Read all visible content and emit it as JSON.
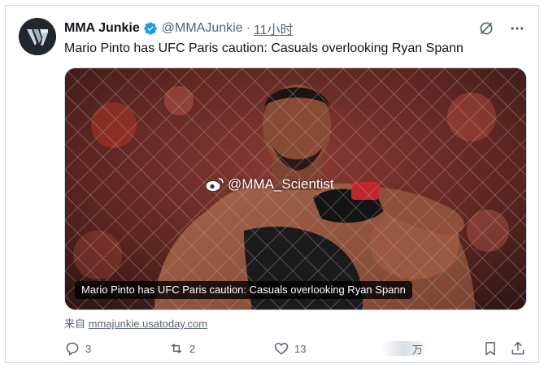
{
  "tweet": {
    "author_name": "MMA Junkie",
    "handle": "@MMAJunkie",
    "separator": "·",
    "time": "11小时",
    "text": "Mario Pinto has UFC Paris caution: Casuals overlooking Ryan Spann",
    "media": {
      "watermark": "@MMA_Scientist",
      "caption": "Mario Pinto has UFC Paris caution: Casuals overlooking Ryan Spann"
    },
    "source_prefix": "来自",
    "source_domain": "mmajunkie.usatoday.com"
  },
  "actions": {
    "replies": "3",
    "reposts": "2",
    "likes": "13",
    "views_suffix": "万"
  },
  "colors": {
    "verified": "#1d9bf0",
    "muted": "#536471",
    "text": "#0f1419",
    "border": "#cfd9de"
  },
  "icons": [
    "avatar-logo",
    "verified-badge-icon",
    "grok-icon",
    "more-icon",
    "weibo-icon",
    "reply-icon",
    "repost-icon",
    "like-icon",
    "views-icon",
    "bookmark-icon",
    "share-icon"
  ]
}
